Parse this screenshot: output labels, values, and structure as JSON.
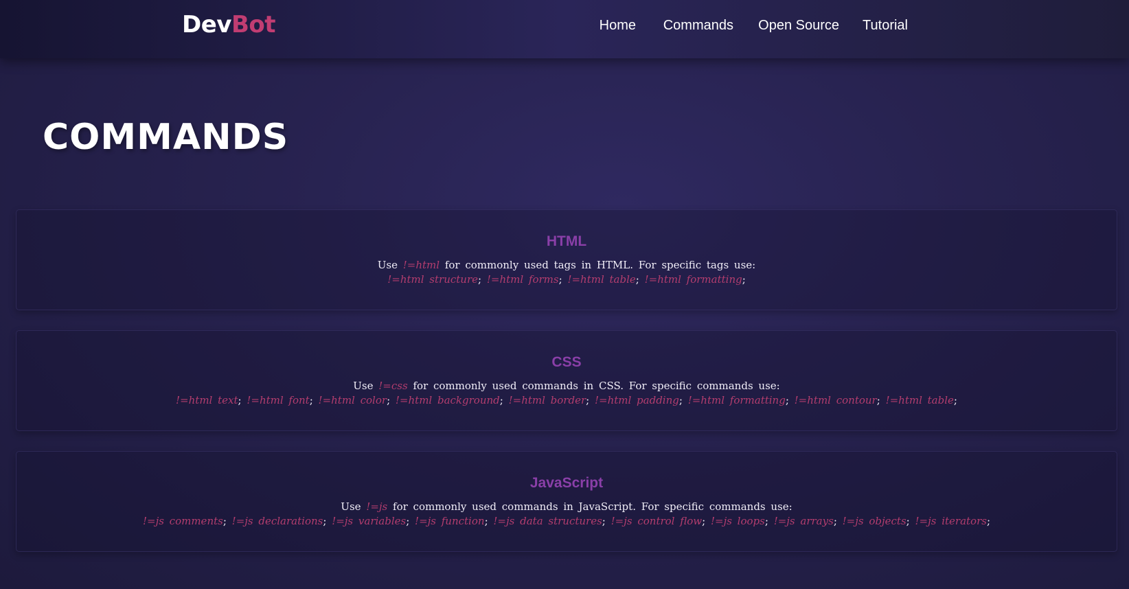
{
  "nav": {
    "logo_part1": "Dev",
    "logo_part2": "Bot",
    "links": [
      "Home",
      "Commands",
      "Open Source",
      "Tutorial"
    ]
  },
  "page": {
    "title": "COMMANDS"
  },
  "sections": [
    {
      "title": "HTML",
      "use_word": "Use",
      "main_command": "!=html",
      "description": "for commonly used tags in HTML. For specific tags use:",
      "commands": [
        "!=html structure",
        "!=html forms",
        "!=html table",
        "!=html formatting"
      ]
    },
    {
      "title": "CSS",
      "use_word": "Use",
      "main_command": "!=css",
      "description": "for commonly used commands in CSS. For specific commands use:",
      "commands": [
        "!=html text",
        "!=html font",
        "!=html color",
        "!=html background",
        "!=html border",
        "!=html padding",
        "!=html formatting",
        "!=html contour",
        "!=html table"
      ]
    },
    {
      "title": "JavaScript",
      "use_word": "Use",
      "main_command": "!=js",
      "description": "for commonly used commands in JavaScript. For specific commands use:",
      "commands": [
        "!=js comments",
        "!=js declarations",
        "!=js variables",
        "!=js function",
        "!=js data structures",
        "!=js control flow",
        "!=js loops",
        "!=js arrays",
        "!=js objects",
        "!=js iterators"
      ]
    }
  ],
  "colors": {
    "accent": "#c13d72",
    "section_title": "#8a3fa8",
    "command": "#b43d6e",
    "background": "#27224f"
  }
}
